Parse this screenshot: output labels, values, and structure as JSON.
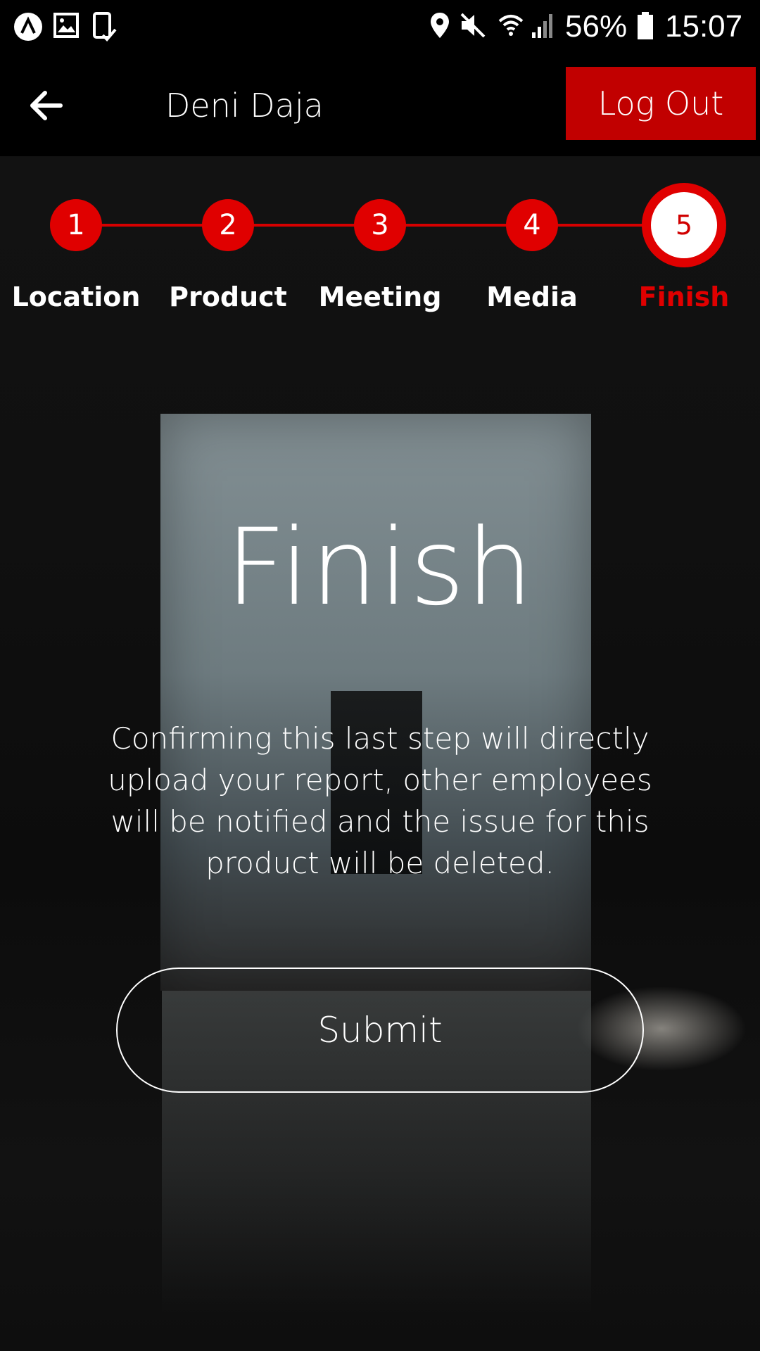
{
  "status_bar": {
    "battery": "56%",
    "time": "15:07",
    "icons": [
      "app-icon",
      "gallery-icon",
      "device-check-icon",
      "location-icon",
      "mute-icon",
      "wifi-icon",
      "signal-icon",
      "battery-icon"
    ]
  },
  "app_bar": {
    "back_icon": "arrow-left-icon",
    "user_name": "Deni Daja",
    "logout_label": "Log Out"
  },
  "stepper": {
    "steps": [
      {
        "number": "1",
        "label": "Location"
      },
      {
        "number": "2",
        "label": "Product"
      },
      {
        "number": "3",
        "label": "Meeting"
      },
      {
        "number": "4",
        "label": "Media"
      },
      {
        "number": "5",
        "label": "Finish"
      }
    ],
    "active_step": 5
  },
  "main": {
    "title": "Finish",
    "description": "Confirming this last step will directly upload your report, other employees will be notified and the issue for this product will be deleted.",
    "submit_label": "Submit"
  },
  "colors": {
    "accent": "#e00000",
    "logout_bg": "#c10000",
    "text": "#ffffff"
  }
}
